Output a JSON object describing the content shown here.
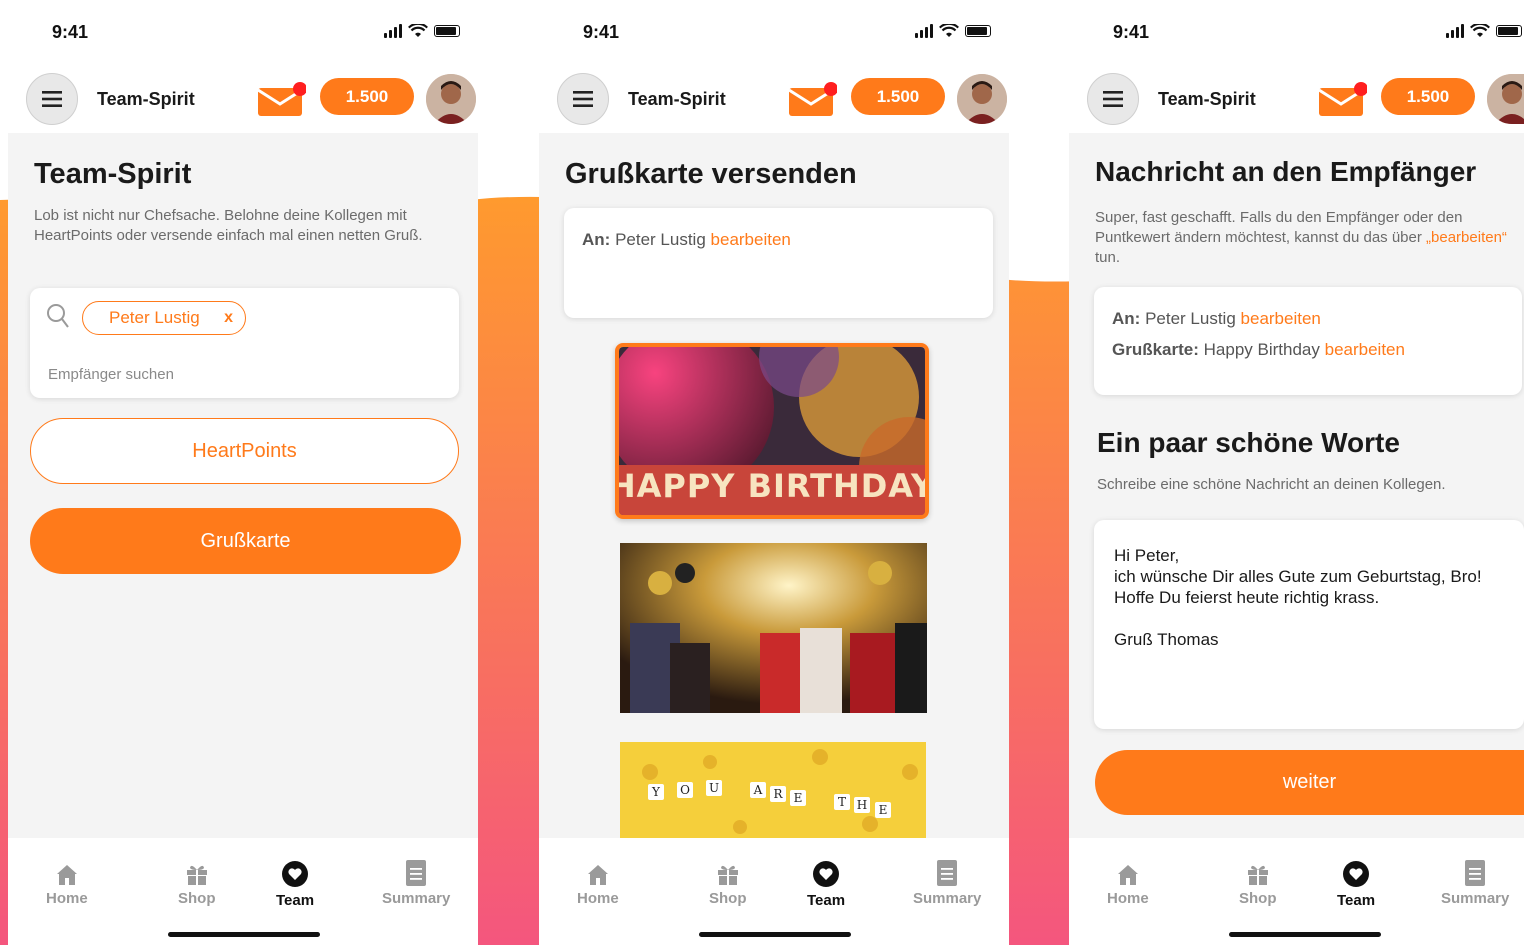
{
  "status": {
    "time": "9:41"
  },
  "header": {
    "title": "Team-Spirit",
    "points": "1.500"
  },
  "colors": {
    "accent": "#ff7a1a",
    "gradient_top": "#ff9a2e",
    "gradient_bottom": "#f4567e"
  },
  "tabs": [
    {
      "label": "Home",
      "icon": "home-icon"
    },
    {
      "label": "Shop",
      "icon": "gift-icon"
    },
    {
      "label": "Team",
      "icon": "heart-icon"
    },
    {
      "label": "Summary",
      "icon": "document-icon"
    }
  ],
  "screen1": {
    "title": "Team-Spirit",
    "description": "Lob ist nicht nur Chefsache. Belohne deine Kollegen mit HeartPoints oder versende einfach mal einen netten Gruß.",
    "chip_label": "Peter Lustig",
    "chip_remove": "x",
    "search_placeholder": "Empfänger suchen",
    "heartpoints_button": "HeartPoints",
    "grusskarte_button": "Grußkarte"
  },
  "screen2": {
    "title": "Grußkarte versenden",
    "to_label": "An:",
    "to_value": "Peter Lustig",
    "edit_link": "bearbeiten",
    "card1_text": "HAPPY BIRTHDAY",
    "card3_letters": [
      "Y",
      "O",
      "U",
      "A",
      "R",
      "E",
      "T",
      "H",
      "E"
    ]
  },
  "screen3": {
    "title": "Nachricht an den Empfänger",
    "description_a": "Super, fast geschafft. Falls du den Empfänger oder den Puntkewert ändern möchtest, kannst du das über",
    "description_link": "„bearbeiten“",
    "description_b": "tun.",
    "to_label": "An:",
    "to_value": "Peter Lustig",
    "card_label": "Grußkarte:",
    "card_value": "Happy Birthday",
    "edit_link": "bearbeiten",
    "section_title": "Ein paar schöne Worte",
    "section_desc": "Schreibe eine schöne Nachricht an deinen Kollegen.",
    "message": "Hi Peter,\nich wünsche Dir alles Gute zum Geburtstag, Bro!\nHoffe Du feierst heute richtig krass.\n\nGruß Thomas",
    "next_button": "weiter"
  }
}
